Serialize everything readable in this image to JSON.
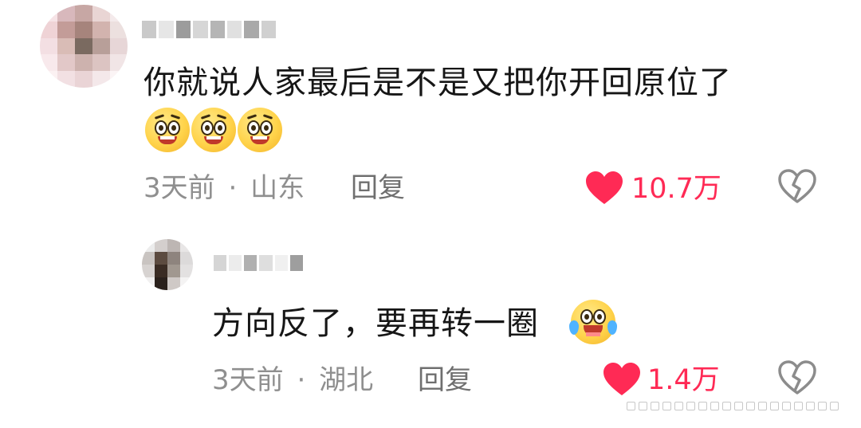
{
  "comments": [
    {
      "text": "你就说人家最后是不是又把你开回原位了",
      "time": "3天前",
      "separator": "·",
      "location": "山东",
      "reply_label": "回复",
      "likes": "10.7万",
      "emojis": [
        "pleading-face-emoji",
        "pleading-face-emoji",
        "pleading-face-emoji"
      ],
      "reply": {
        "text": "方向反了，要再转一圈",
        "time": "3天前",
        "separator": "·",
        "location": "湖北",
        "reply_label": "回复",
        "likes": "1.4万",
        "emojis": [
          "tears-of-joy-emoji"
        ]
      }
    }
  ],
  "icons": {
    "like": "heart-icon",
    "dislike": "broken-heart-icon"
  },
  "colors": {
    "like_red": "#ff2a55",
    "meta_gray": "#8f8f8f",
    "text_dark": "#161616"
  }
}
